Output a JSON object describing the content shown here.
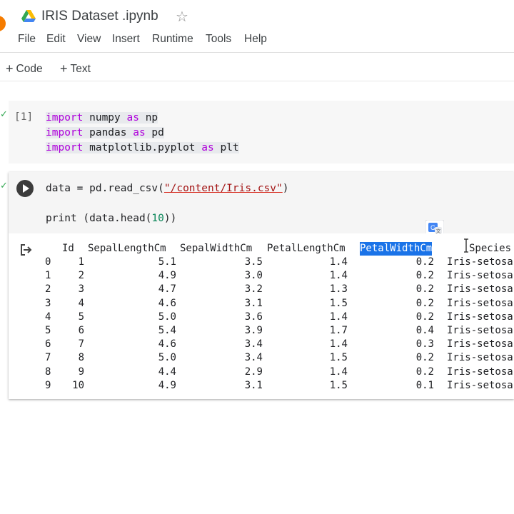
{
  "notebook": {
    "title": "IRIS Dataset .ipynb",
    "star_icon": "star-outline-icon",
    "logo_icon": "google-drive-logo",
    "accent_color": "#f57c00"
  },
  "menu": [
    "File",
    "Edit",
    "View",
    "Insert",
    "Runtime",
    "Tools",
    "Help"
  ],
  "toolbar": {
    "code_label": "Code",
    "text_label": "Text"
  },
  "cells": [
    {
      "execution_count": "[1]",
      "code": [
        {
          "kw": "import",
          "rest": " numpy ",
          "kw2": "as",
          "rest2": " np"
        },
        {
          "kw": "import",
          "rest": " pandas ",
          "kw2": "as",
          "rest2": " pd"
        },
        {
          "kw": "import",
          "rest": " matplotlib.pyplot ",
          "kw2": "as",
          "rest2": " plt"
        }
      ]
    },
    {
      "code_line1_prefix": "data = pd.read_csv(",
      "code_line1_string": "\"/content/Iris.csv\"",
      "code_line1_suffix": ")",
      "code_line2_prefix": "print (data.head(",
      "code_line2_number": "10",
      "code_line2_suffix": "))"
    }
  ],
  "output": {
    "columns": [
      "Id",
      "SepalLengthCm",
      "SepalWidthCm",
      "PetalLengthCm",
      "PetalWidthCm",
      "Species"
    ],
    "highlighted_column": "PetalWidthCm",
    "rows": [
      [
        "0",
        "1",
        "5.1",
        "3.5",
        "1.4",
        "0.2",
        "Iris-setosa"
      ],
      [
        "1",
        "2",
        "4.9",
        "3.0",
        "1.4",
        "0.2",
        "Iris-setosa"
      ],
      [
        "2",
        "3",
        "4.7",
        "3.2",
        "1.3",
        "0.2",
        "Iris-setosa"
      ],
      [
        "3",
        "4",
        "4.6",
        "3.1",
        "1.5",
        "0.2",
        "Iris-setosa"
      ],
      [
        "4",
        "5",
        "5.0",
        "3.6",
        "1.4",
        "0.2",
        "Iris-setosa"
      ],
      [
        "5",
        "6",
        "5.4",
        "3.9",
        "1.7",
        "0.4",
        "Iris-setosa"
      ],
      [
        "6",
        "7",
        "4.6",
        "3.4",
        "1.4",
        "0.3",
        "Iris-setosa"
      ],
      [
        "7",
        "8",
        "5.0",
        "3.4",
        "1.5",
        "0.2",
        "Iris-setosa"
      ],
      [
        "8",
        "9",
        "4.4",
        "2.9",
        "1.4",
        "0.2",
        "Iris-setosa"
      ],
      [
        "9",
        "10",
        "4.9",
        "3.1",
        "1.5",
        "0.1",
        "Iris-setosa"
      ]
    ]
  }
}
